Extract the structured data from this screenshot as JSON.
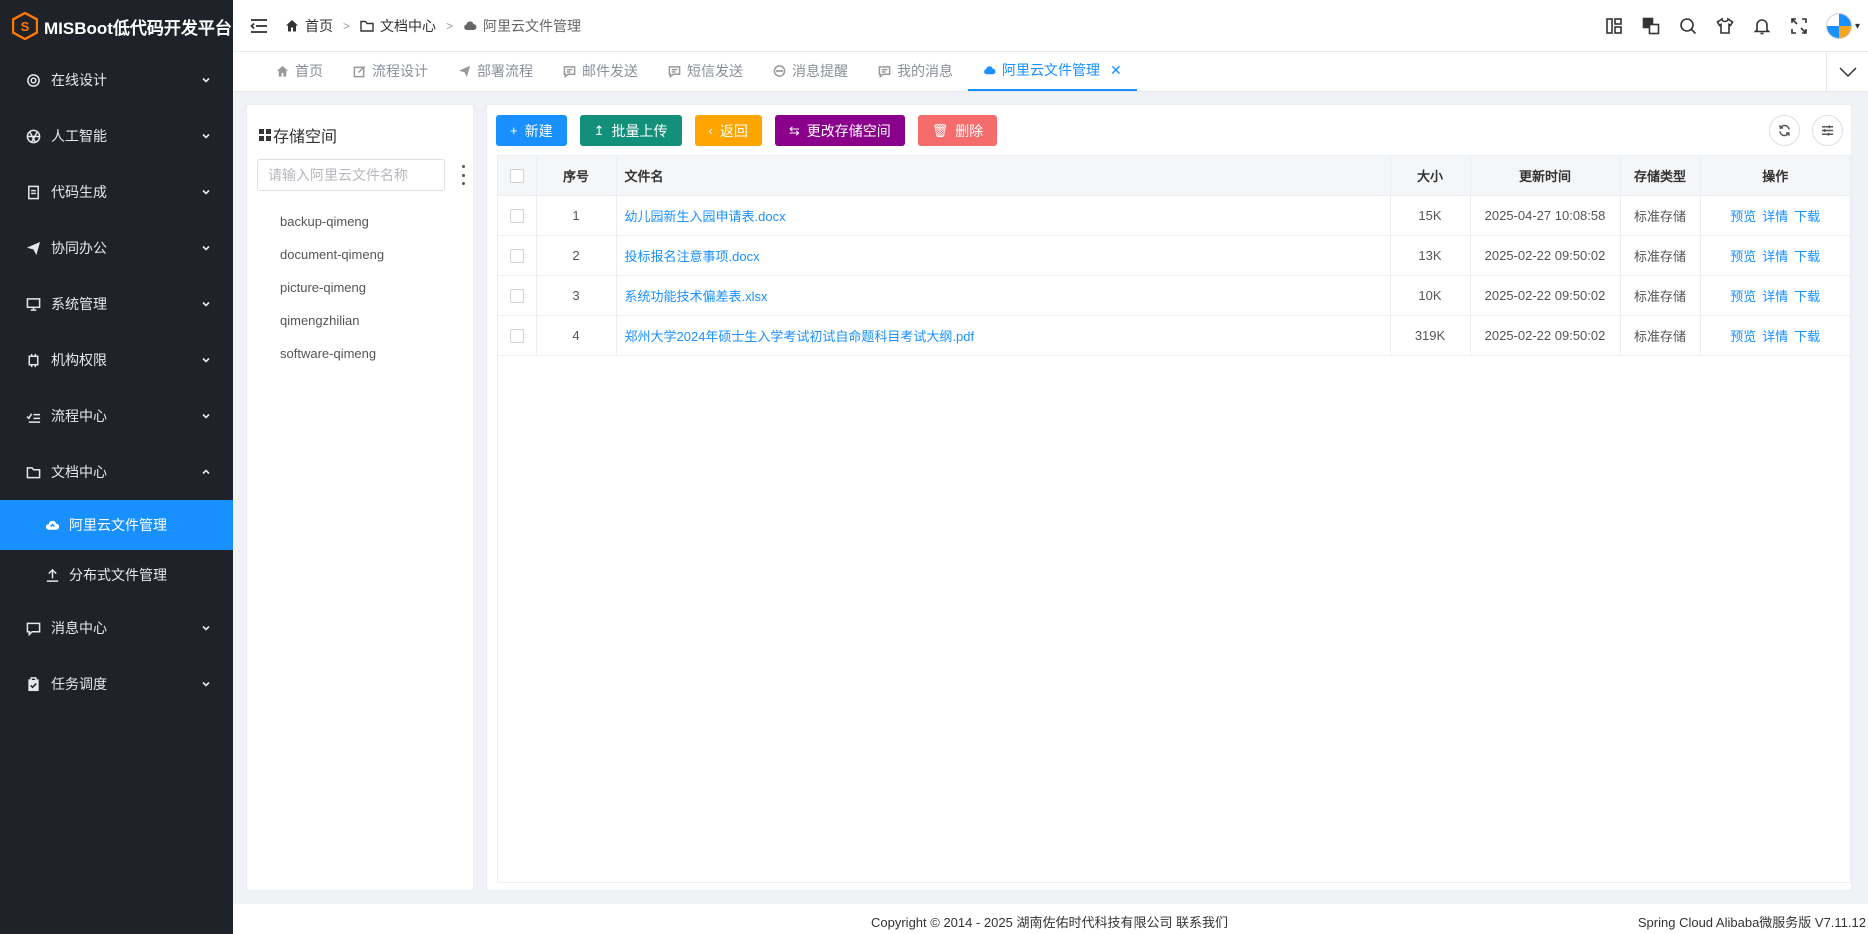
{
  "brand": {
    "title": "MISBoot低代码开发平台",
    "accent": "#ff7a00"
  },
  "sidebar": {
    "items": [
      {
        "label": "在线设计",
        "icon": "gear-icon"
      },
      {
        "label": "人工智能",
        "icon": "aperture-icon"
      },
      {
        "label": "代码生成",
        "icon": "document-icon"
      },
      {
        "label": "协同办公",
        "icon": "paper-plane-icon"
      },
      {
        "label": "系统管理",
        "icon": "monitor-icon"
      },
      {
        "label": "机构权限",
        "icon": "cog-icon"
      },
      {
        "label": "流程中心",
        "icon": "checklist-icon"
      },
      {
        "label": "文档中心",
        "icon": "folder-icon"
      },
      {
        "label": "消息中心",
        "icon": "chat-icon"
      },
      {
        "label": "任务调度",
        "icon": "clipboard-icon"
      }
    ],
    "submenu": [
      {
        "label": "阿里云文件管理",
        "icon": "cloud-upload-icon"
      },
      {
        "label": "分布式文件管理",
        "icon": "upload-icon"
      }
    ]
  },
  "breadcrumb": [
    "首页",
    "文档中心",
    "阿里云文件管理"
  ],
  "tabs": [
    "首页",
    "流程设计",
    "部署流程",
    "邮件发送",
    "短信发送",
    "消息提醒",
    "我的消息",
    "阿里云文件管理"
  ],
  "storage": {
    "title": "存储空间",
    "search_placeholder": "请输入阿里云文件名称",
    "buckets": [
      "backup-qimeng",
      "document-qimeng",
      "picture-qimeng",
      "qimengzhilian",
      "software-qimeng"
    ]
  },
  "toolbar": {
    "new": "新建",
    "upload": "批量上传",
    "back": "返回",
    "change": "更改存储空间",
    "delete": "删除"
  },
  "table": {
    "headers": {
      "seq": "序号",
      "name": "文件名",
      "size": "大小",
      "time": "更新时间",
      "type": "存储类型",
      "op": "操作"
    },
    "ops": {
      "preview": "预览",
      "detail": "详情",
      "download": "下载"
    },
    "rows": [
      {
        "seq": "1",
        "name": "幼儿园新生入园申请表.docx",
        "size": "15K",
        "time": "2025-04-27 10:08:58",
        "type": "标准存储"
      },
      {
        "seq": "2",
        "name": "投标报名注意事项.docx",
        "size": "13K",
        "time": "2025-02-22 09:50:02",
        "type": "标准存储"
      },
      {
        "seq": "3",
        "name": "系统功能技术偏差表.xlsx",
        "size": "10K",
        "time": "2025-02-22 09:50:02",
        "type": "标准存储"
      },
      {
        "seq": "4",
        "name": "郑州大学2024年硕士生入学考试初试自命题科目考试大纲.pdf",
        "size": "319K",
        "time": "2025-02-22 09:50:02",
        "type": "标准存储"
      }
    ]
  },
  "footer": {
    "copyright": "Copyright © 2014 - 2025 湖南佐佑时代科技有限公司 联系我们",
    "version": "Spring Cloud Alibaba微服务版 V7.11.12"
  }
}
